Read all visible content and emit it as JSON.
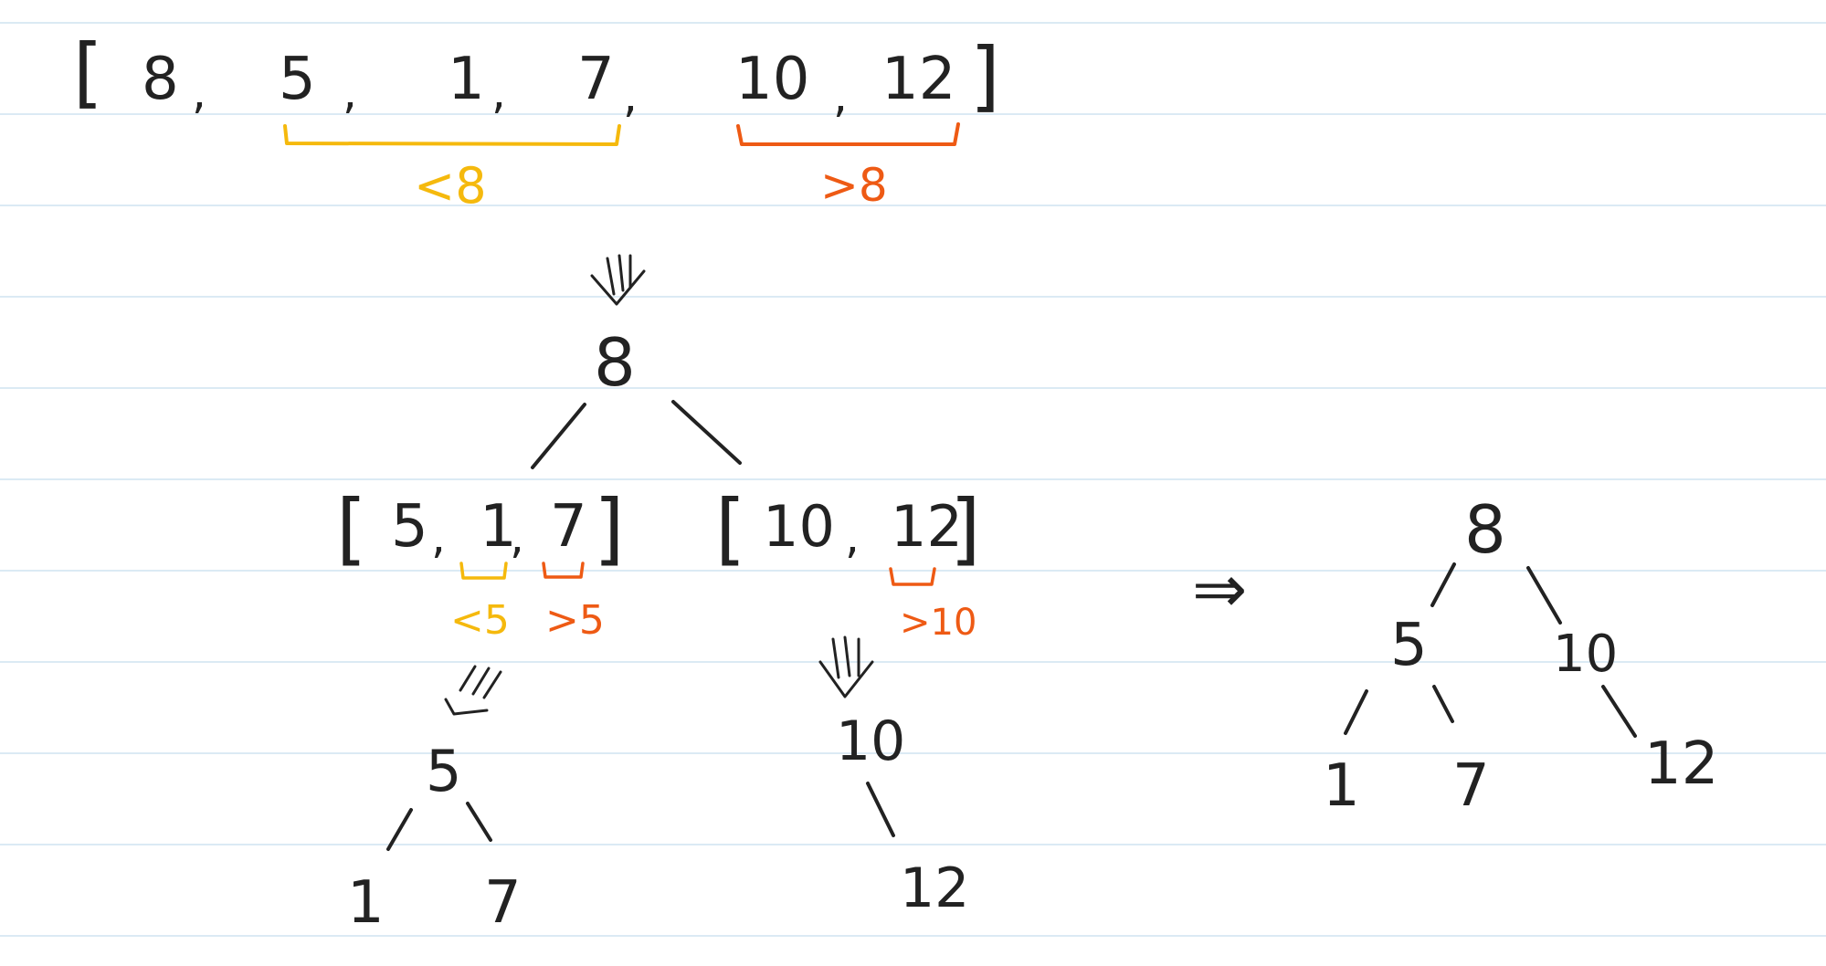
{
  "colors": {
    "ink": "#222222",
    "less_than_bracket": "#f5b90d",
    "greater_than_bracket": "#ee5a14",
    "ruled_line": "#cfe3f0",
    "paper": "#ffffff"
  },
  "top_array": {
    "open_bracket": "[",
    "items": [
      "8",
      ",",
      "5",
      ",",
      "1",
      ",",
      "7",
      ",",
      "10",
      ",",
      "12"
    ],
    "close_bracket": "]",
    "left_partition_label": "<8",
    "right_partition_label": ">8"
  },
  "step1": {
    "arrow_icon": "down-arrow-icon",
    "root": "8"
  },
  "left_subarray": {
    "open_bracket": "[",
    "items": [
      "5",
      ",",
      "1",
      ",",
      "7"
    ],
    "close_bracket": "]",
    "left_partition_label": "<5",
    "right_partition_label": ">5"
  },
  "right_subarray": {
    "open_bracket": "[",
    "items": [
      "10",
      ",",
      "12"
    ],
    "close_bracket": "]",
    "right_partition_label": ">10"
  },
  "left_subtree": {
    "root": "5",
    "left_child": "1",
    "right_child": "7"
  },
  "right_subtree": {
    "root": "10",
    "right_child": "12"
  },
  "result_arrow": "⇒",
  "final_tree": {
    "root": "8",
    "left": "5",
    "right": "10",
    "left_left": "1",
    "left_right": "7",
    "right_right": "12"
  }
}
